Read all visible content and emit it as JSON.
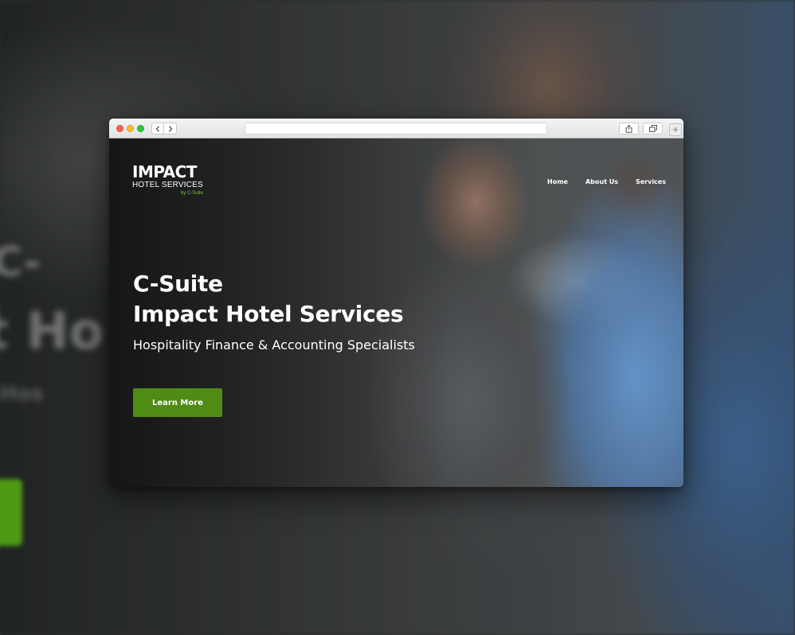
{
  "backdrop": {
    "ghost_line_1": "C-",
    "ghost_line_2": "t Ho",
    "ghost_line_3": "Hos"
  },
  "browser": {
    "back_icon": "chevron-left-icon",
    "forward_icon": "chevron-right-icon",
    "address_text": "",
    "share_icon": "share-icon",
    "tabs_icon": "tabs-overview-icon",
    "new_tab_symbol": "+"
  },
  "site": {
    "logo": {
      "main": "IMPACT",
      "sub": "HOTEL SERVICES",
      "by": "by C-Suite"
    },
    "nav": [
      {
        "label": "Home"
      },
      {
        "label": "About Us"
      },
      {
        "label": "Services"
      }
    ],
    "hero": {
      "title_line_1": "C-Suite",
      "title_line_2": "Impact Hotel Services",
      "subtitle": "Hospitality Finance & Accounting Specialists",
      "cta_label": "Learn More"
    },
    "colors": {
      "accent": "#4f8c13",
      "logo_green": "#7dc242"
    }
  }
}
